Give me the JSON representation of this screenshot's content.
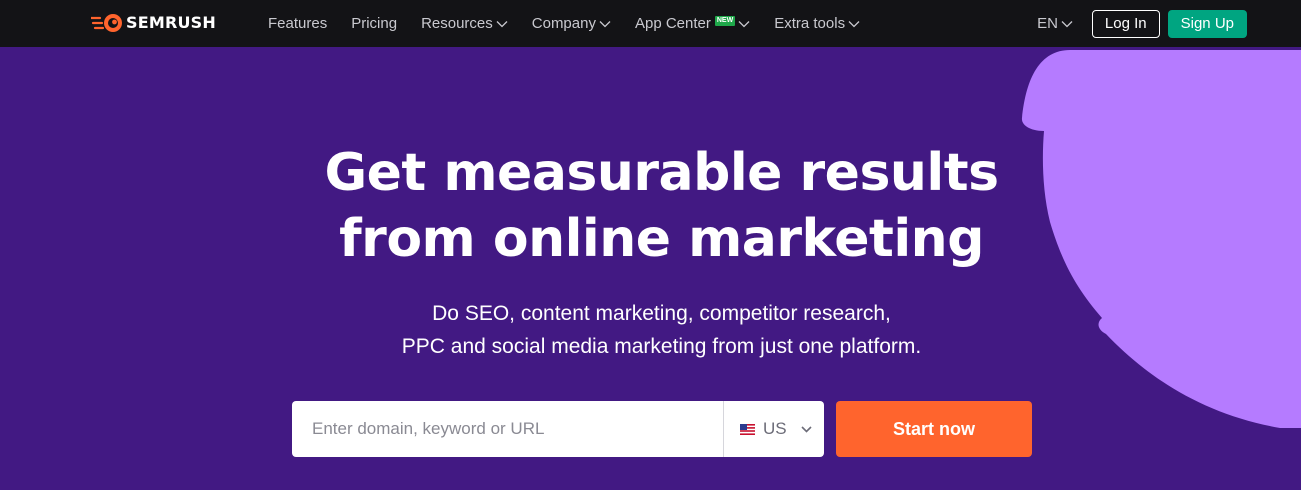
{
  "brand": {
    "name": "SEMRUSH",
    "accent": "#ff642d"
  },
  "nav": {
    "items": [
      {
        "label": "Features",
        "has_dropdown": false
      },
      {
        "label": "Pricing",
        "has_dropdown": false
      },
      {
        "label": "Resources",
        "has_dropdown": true
      },
      {
        "label": "Company",
        "has_dropdown": true
      },
      {
        "label": "App Center",
        "has_dropdown": true,
        "badge": "NEW"
      },
      {
        "label": "Extra tools",
        "has_dropdown": true
      }
    ],
    "language": "EN",
    "login_label": "Log In",
    "signup_label": "Sign Up"
  },
  "hero": {
    "title_line1": "Get measurable results",
    "title_line2": "from online marketing",
    "subtitle_line1": "Do SEO, content marketing, competitor research,",
    "subtitle_line2": "PPC and social media marketing from just one platform."
  },
  "search": {
    "placeholder": "Enter domain, keyword or URL",
    "value": "",
    "database": "US",
    "database_icon": "us-flag-icon",
    "submit_label": "Start now"
  },
  "colors": {
    "background": "#421983",
    "topbar": "#131316",
    "decor_shape": "#b57bff",
    "signup": "#00a581",
    "cta": "#ff642d"
  }
}
